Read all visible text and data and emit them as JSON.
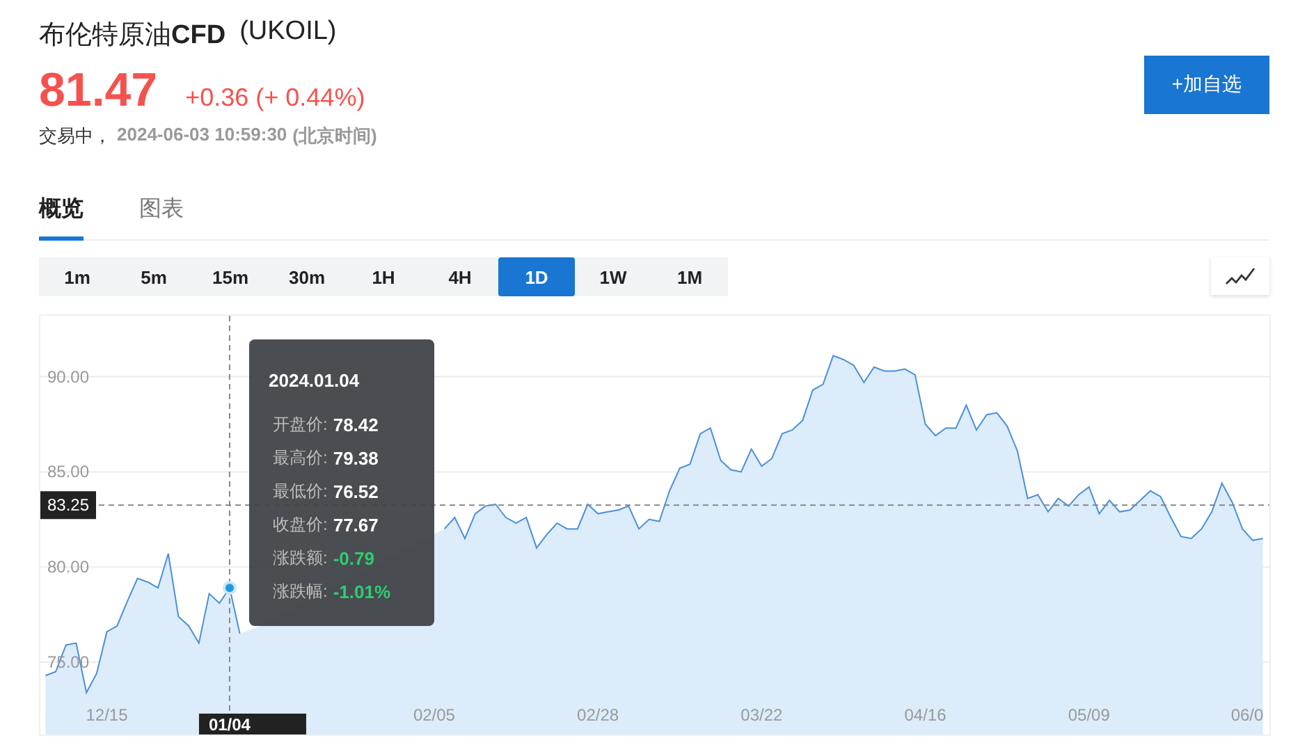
{
  "header": {
    "name": "布伦特原油**CFD**",
    "symbol": "(UKOIL)",
    "price": "81.47",
    "change": "+0.36",
    "change_pct": "(+ 0.44%)",
    "status": "交易中，",
    "time": "2024-06-03 10:59:30",
    "timezone": "(北京时间)",
    "watch_button": "+加自选"
  },
  "tabs": [
    {
      "label": "概览",
      "selected": true
    },
    {
      "label": "图表",
      "selected": false
    }
  ],
  "periods": [
    {
      "label": "1m",
      "selected": false
    },
    {
      "label": "5m",
      "selected": false
    },
    {
      "label": "15m",
      "selected": false
    },
    {
      "label": "30m",
      "selected": false
    },
    {
      "label": "1H",
      "selected": false
    },
    {
      "label": "4H",
      "selected": false
    },
    {
      "label": "1D",
      "selected": true
    },
    {
      "label": "1W",
      "selected": false
    },
    {
      "label": "1M",
      "selected": false
    }
  ],
  "chart": {
    "chart_data": {
      "type": "area",
      "grid": true,
      "ylim": [
        71.2,
        93.2
      ],
      "categories": [
        null,
        null,
        null,
        null,
        null,
        null,
        "12/15",
        null,
        null,
        null,
        null,
        null,
        null,
        null,
        null,
        null,
        null,
        null,
        "01/04",
        null,
        null,
        null,
        null,
        null,
        null,
        null,
        null,
        null,
        null,
        null,
        null,
        null,
        null,
        null,
        null,
        null,
        null,
        null,
        "02/05",
        null,
        null,
        null,
        null,
        null,
        null,
        null,
        null,
        null,
        null,
        null,
        null,
        null,
        null,
        null,
        "02/28",
        null,
        null,
        null,
        null,
        null,
        null,
        null,
        null,
        null,
        null,
        null,
        null,
        null,
        null,
        null,
        "03/22",
        null,
        null,
        null,
        null,
        null,
        null,
        null,
        null,
        null,
        null,
        null,
        null,
        null,
        null,
        null,
        "04/16",
        null,
        null,
        null,
        null,
        null,
        null,
        null,
        null,
        null,
        null,
        null,
        null,
        null,
        null,
        null,
        "05/09",
        null,
        null,
        null,
        null,
        null,
        null,
        null,
        null,
        null,
        null,
        null,
        null,
        null,
        null,
        null,
        "06/0",
        null
      ],
      "yticks": [
        {
          "value": 75,
          "label": "75.00"
        },
        {
          "value": 80,
          "label": "80.00"
        },
        {
          "value": 85,
          "label": "85.00"
        },
        {
          "value": 90,
          "label": "90.00"
        }
      ],
      "series": [
        {
          "color": "#4a90d9",
          "values": [
            74.3,
            74.5,
            75.9,
            76.0,
            73.4,
            74.4,
            76.6,
            76.9,
            78.2,
            79.4,
            79.2,
            78.9,
            80.7,
            77.4,
            76.9,
            76.0,
            78.6,
            78.1,
            78.9,
            76.5,
            null,
            76.9,
            null,
            null,
            null,
            null,
            null,
            null,
            null,
            null,
            null,
            null,
            null,
            null,
            null,
            null,
            null,
            null,
            null,
            82.0,
            82.6,
            81.5,
            82.8,
            83.2,
            83.3,
            82.6,
            82.3,
            82.6,
            81.0,
            81.7,
            82.3,
            82.0,
            82.0,
            83.3,
            82.8,
            82.9,
            83.0,
            83.2,
            82.0,
            82.5,
            82.4,
            84.0,
            85.2,
            85.4,
            87.0,
            87.3,
            85.6,
            85.1,
            85.0,
            86.2,
            85.3,
            85.7,
            87.0,
            87.2,
            87.7,
            89.3,
            89.6,
            91.1,
            90.9,
            90.6,
            89.7,
            90.5,
            90.3,
            90.3,
            90.4,
            90.1,
            87.5,
            86.9,
            87.3,
            87.3,
            88.5,
            87.2,
            88.0,
            88.1,
            87.4,
            86.1,
            83.6,
            83.8,
            82.9,
            83.6,
            83.2,
            83.8,
            84.2,
            82.8,
            83.5,
            82.9,
            83.0,
            83.5,
            84.0,
            83.7,
            82.6,
            81.6,
            81.5,
            82.0,
            82.9,
            84.4,
            83.4,
            82.0,
            81.4,
            81.5
          ]
        }
      ],
      "ref_lines": [
        {
          "axis": "y",
          "value": 83.25,
          "label": "83.25"
        },
        {
          "axis": "x",
          "value": "01/04"
        }
      ]
    },
    "tooltip": {
      "date": "2024.01.04",
      "rows": [
        {
          "label": "开盘价:",
          "value": "78.42",
          "negative": false
        },
        {
          "label": "最高价:",
          "value": "79.38",
          "negative": false
        },
        {
          "label": "最低价:",
          "value": "76.52",
          "negative": false
        },
        {
          "label": "收盘价:",
          "value": "77.67",
          "negative": false
        },
        {
          "label": "涨跌额:",
          "value": "-0.79",
          "negative": true
        },
        {
          "label": "涨跌幅:",
          "value": "-1.01%",
          "negative": true
        }
      ]
    }
  }
}
